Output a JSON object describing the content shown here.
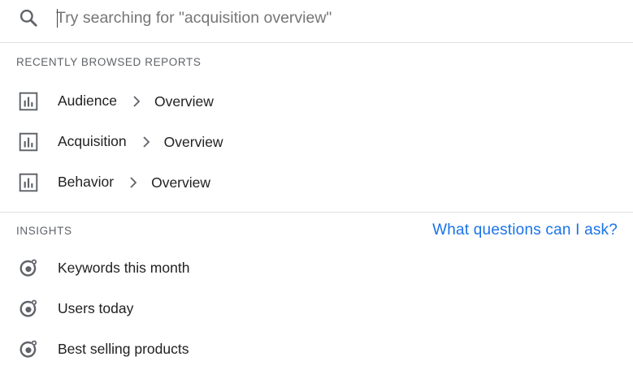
{
  "search": {
    "placeholder": "Try searching for \"acquisition overview\"",
    "icon": "search-icon"
  },
  "recent": {
    "heading": "RECENTLY BROWSED REPORTS",
    "icon": "report-chart-icon",
    "items": [
      {
        "category": "Audience",
        "report": "Overview"
      },
      {
        "category": "Acquisition",
        "report": "Overview"
      },
      {
        "category": "Behavior",
        "report": "Overview"
      }
    ]
  },
  "insights": {
    "heading": "INSIGHTS",
    "help_link": "What questions can I ask?",
    "icon": "insights-icon",
    "items": [
      {
        "label": "Keywords this month"
      },
      {
        "label": "Users today"
      },
      {
        "label": "Best selling products"
      }
    ]
  },
  "colors": {
    "link": "#1a73e8",
    "divider": "#e0e0e0",
    "icon": "#5f6368",
    "text": "#212121",
    "heading": "#5f6368"
  }
}
